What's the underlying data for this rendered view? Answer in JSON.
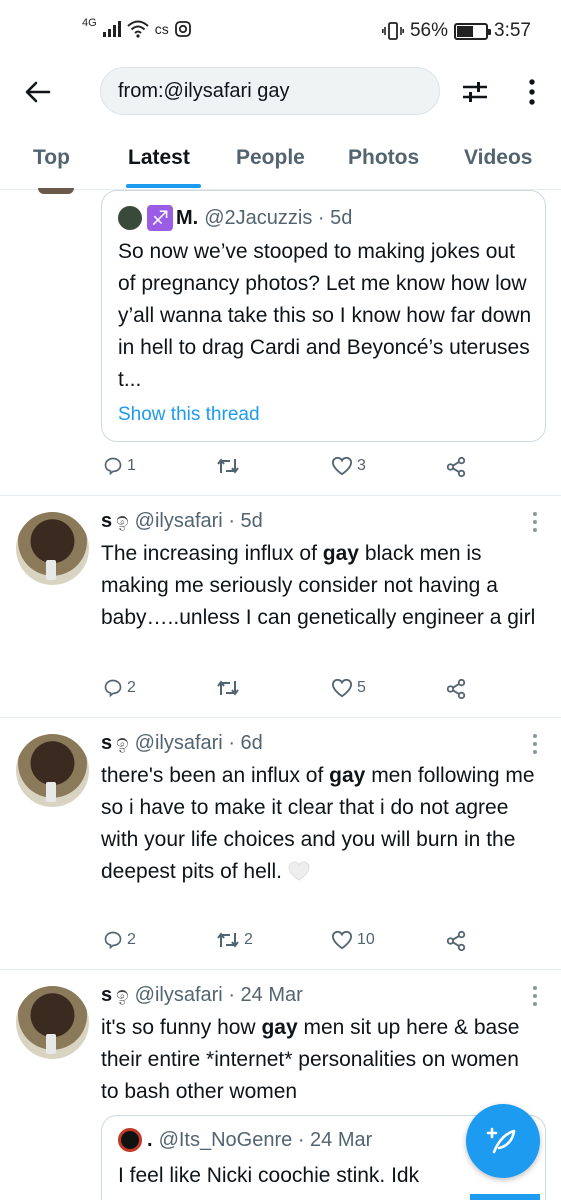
{
  "status_bar": {
    "network": "4G",
    "battery_percent": "56%",
    "battery_level": 0.56,
    "time": "3:57"
  },
  "search": {
    "query": "from:@ilysafari gay"
  },
  "tabs": [
    {
      "label": "Top",
      "active": false
    },
    {
      "label": "Latest",
      "active": true
    },
    {
      "label": "People",
      "active": false
    },
    {
      "label": "Photos",
      "active": false
    },
    {
      "label": "Videos",
      "active": false
    }
  ],
  "quoted_tweet_1": {
    "name": "M.",
    "handle": "@2Jacuzzis",
    "time": "5d",
    "text": "So now we’ve stooped to making jokes out of pregnancy photos? Let me know how low y’all wanna take this so I know how far down in hell to drag Cardi and Beyoncé’s uteruses t...",
    "show_thread": "Show this thread",
    "actions": {
      "replies": "1",
      "retweets": "",
      "likes": "3"
    }
  },
  "tweets": [
    {
      "name": "s",
      "handle": "@ilysafari",
      "time": "5d",
      "text_before": "The increasing influx of ",
      "text_bold": "gay",
      "text_after": " black men is making me seriously consider not having a baby…..unless I can genetically engineer a girl",
      "actions": {
        "replies": "2",
        "retweets": "",
        "likes": "5"
      }
    },
    {
      "name": "s",
      "handle": "@ilysafari",
      "time": "6d",
      "text_before": "there's been an influx of ",
      "text_bold": "gay",
      "text_after": " men following me so i have to make it clear that i do not agree with your life choices and you will burn in the deepest pits of hell. ",
      "actions": {
        "replies": "2",
        "retweets": "2",
        "likes": "10"
      }
    },
    {
      "name": "s",
      "handle": "@ilysafari",
      "time": "24 Mar",
      "text_before": "it's so funny how ",
      "text_bold": "gay",
      "text_after": " men sit up here & base their entire *internet* personalities on women to bash other women"
    }
  ],
  "quoted_tweet_2": {
    "name": ".",
    "handle": "@Its_NoGenre",
    "time": "24 Mar",
    "text": "I feel like Nicki coochie stink. Idk"
  },
  "colors": {
    "accent": "#1d9bf0",
    "secondary_text": "#536471",
    "zodiac_badge": "#9b5de5"
  }
}
